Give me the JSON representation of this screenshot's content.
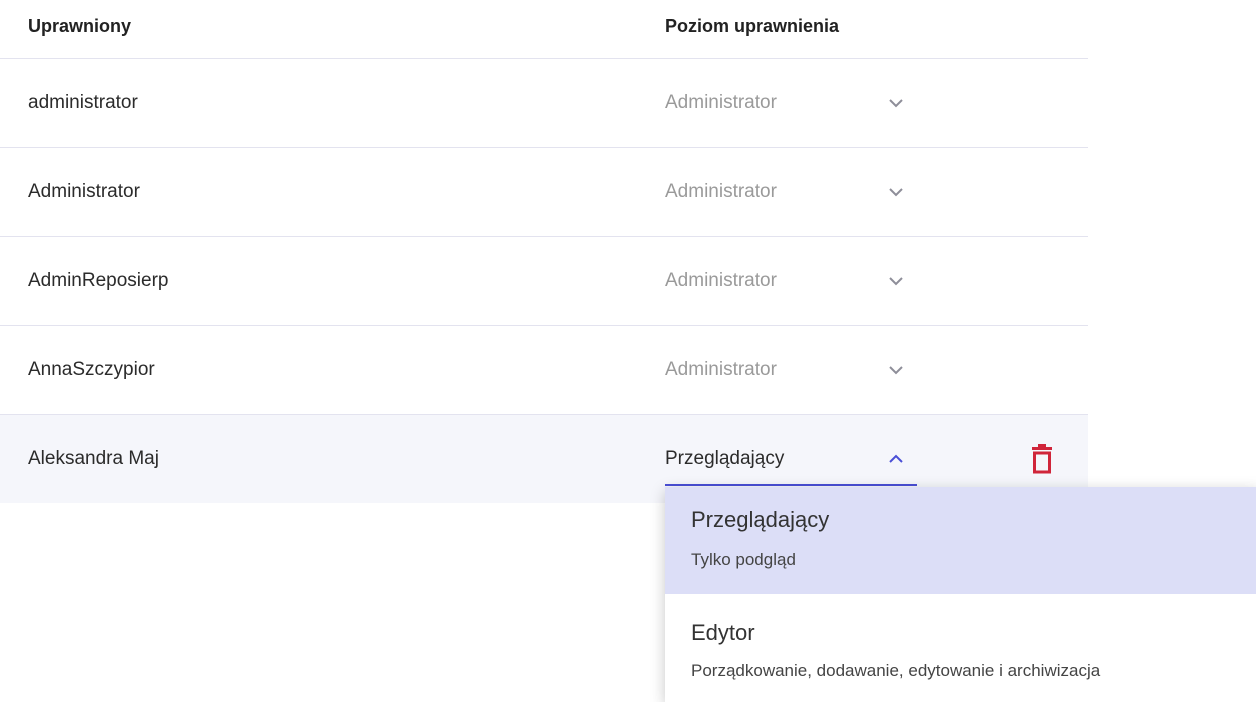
{
  "table": {
    "header": {
      "user_col": "Uprawniony",
      "level_col": "Poziom uprawnienia"
    },
    "rows": [
      {
        "user": "administrator",
        "level": "Administrator"
      },
      {
        "user": "Administrator",
        "level": "Administrator"
      },
      {
        "user": "AdminReposierp",
        "level": "Administrator"
      },
      {
        "user": "AnnaSzczypior",
        "level": "Administrator"
      },
      {
        "user": "Aleksandra Maj",
        "level": "Przeglądający"
      }
    ]
  },
  "dropdown": {
    "options": [
      {
        "title": "Przeglądający",
        "description": "Tylko podgląd"
      },
      {
        "title": "Edytor",
        "description": "Porządkowanie, dodawanie, edytowanie i archiwizacja"
      }
    ]
  },
  "icons": {
    "row_dropdown": "chevron-down-icon",
    "active_dropdown": "chevron-up-icon",
    "delete": "trash-icon"
  },
  "colors": {
    "accent": "#4a4fd6",
    "delete": "#d0253a",
    "selected_option_bg": "#dcdef7",
    "active_row_bg": "#f5f6fb"
  }
}
